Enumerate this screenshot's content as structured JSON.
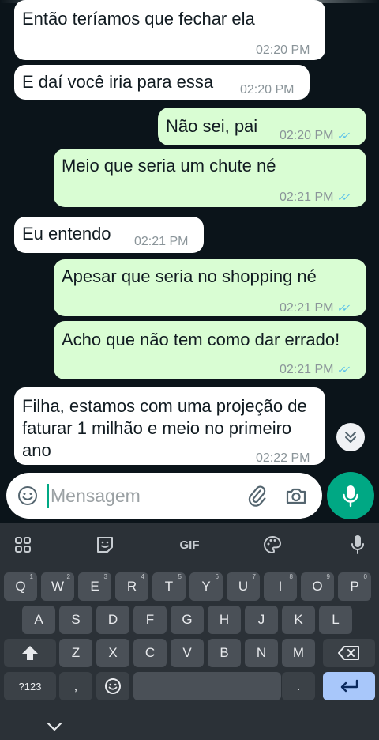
{
  "messages": [
    {
      "dir": "in",
      "text": "Então teríamos que fechar ela",
      "time": "02:20 PM"
    },
    {
      "dir": "in",
      "text": "E daí você iria para essa",
      "time": "02:20 PM"
    },
    {
      "dir": "out",
      "text": "Não sei, pai",
      "time": "02:20 PM",
      "status": "read"
    },
    {
      "dir": "out",
      "text": "Meio que seria um chute né",
      "time": "02:21 PM",
      "status": "read"
    },
    {
      "dir": "in",
      "text": "Eu entendo",
      "time": "02:21 PM"
    },
    {
      "dir": "out",
      "text": "Apesar que seria no shopping né",
      "time": "02:21 PM",
      "status": "read"
    },
    {
      "dir": "out",
      "text": "Acho que não tem como dar errado!",
      "time": "02:21 PM",
      "status": "read"
    },
    {
      "dir": "in",
      "text": "Filha, estamos com uma projeção de faturar 1 milhão e meio no primeiro ano",
      "time": "02:22 PM"
    }
  ],
  "composer": {
    "placeholder": "Mensagem",
    "value": ""
  },
  "icons": {
    "emoji": "smiley-icon",
    "attach": "paperclip-icon",
    "camera": "camera-icon",
    "mic": "microphone-icon",
    "scroll_down": "double-chevron-down-icon",
    "read_receipt": "double-check-icon"
  },
  "keyboard": {
    "toolbar": {
      "gif_label": "GIF"
    },
    "row1": [
      {
        "label": "Q",
        "sup": "1"
      },
      {
        "label": "W",
        "sup": "2"
      },
      {
        "label": "E",
        "sup": "3"
      },
      {
        "label": "R",
        "sup": "4"
      },
      {
        "label": "T",
        "sup": "5"
      },
      {
        "label": "Y",
        "sup": "6"
      },
      {
        "label": "U",
        "sup": "7"
      },
      {
        "label": "I",
        "sup": "8"
      },
      {
        "label": "O",
        "sup": "9"
      },
      {
        "label": "P",
        "sup": "0"
      }
    ],
    "row2": [
      "A",
      "S",
      "D",
      "F",
      "G",
      "H",
      "J",
      "K",
      "L"
    ],
    "row3": [
      "Z",
      "X",
      "C",
      "V",
      "B",
      "N",
      "M"
    ],
    "symbols_label": "?123",
    "comma_label": ",",
    "period_label": "."
  },
  "colors": {
    "background": "#0b141a",
    "incoming": "#ffffff",
    "outgoing": "#d9fdd3",
    "accent": "#00a884",
    "read_tick": "#53bdeb",
    "keyboard_bg": "#2b3137",
    "key_bg": "#4a5057",
    "enter_key": "#a8c7fa"
  }
}
